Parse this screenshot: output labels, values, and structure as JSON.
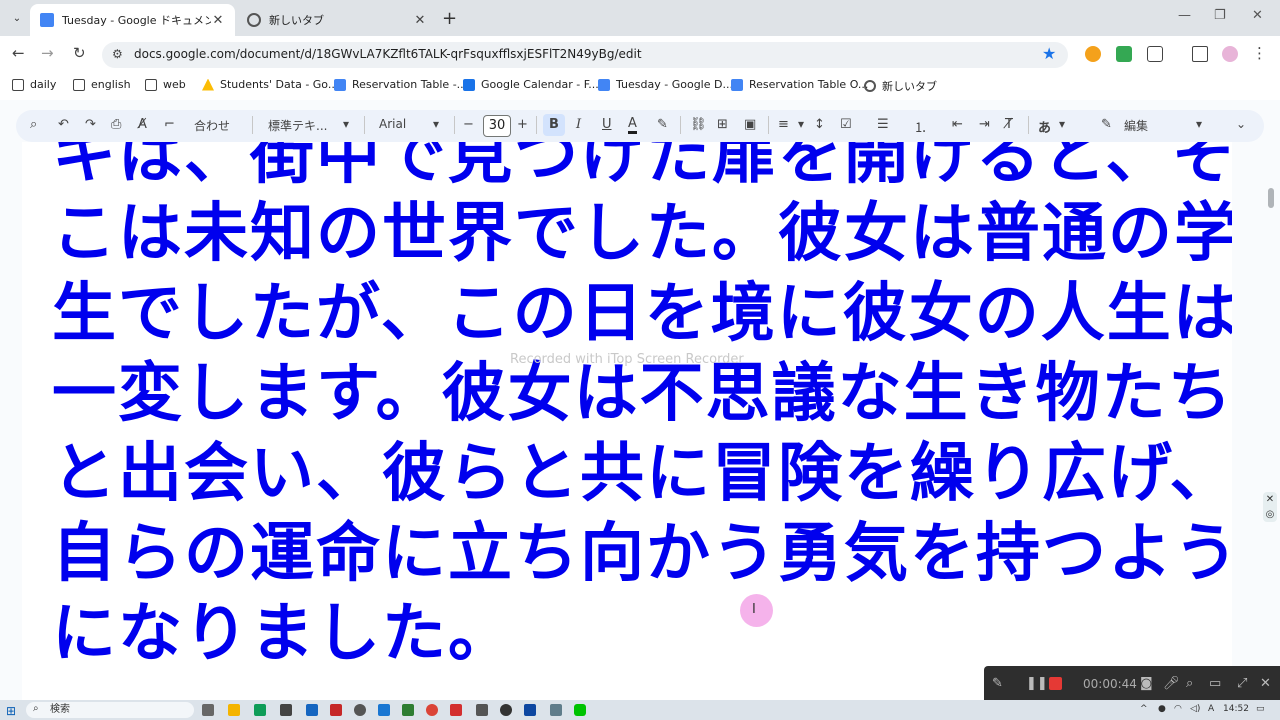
{
  "browser": {
    "tabs": [
      {
        "label": "Tuesday - Google ドキュメント",
        "active": true
      },
      {
        "label": "新しいタブ",
        "active": false
      }
    ],
    "url": "docs.google.com/document/d/18GWvLA7KZflt6TALK-qrFsquxfflsxjESFlT2N49yBg/edit"
  },
  "bookmarks": [
    {
      "label": "daily",
      "icon": "folder-icon"
    },
    {
      "label": "english",
      "icon": "folder-icon"
    },
    {
      "label": "web",
      "icon": "folder-icon"
    },
    {
      "label": "Students' Data - Go...",
      "icon": "drive-icon"
    },
    {
      "label": "Reservation Table -...",
      "icon": "docs-icon"
    },
    {
      "label": "Google Calendar - F...",
      "icon": "calendar-icon"
    },
    {
      "label": "Tuesday - Google D...",
      "icon": "docs-icon"
    },
    {
      "label": "Reservation Table O...",
      "icon": "docs-icon"
    },
    {
      "label": "新しいタブ",
      "icon": "chrome-icon"
    }
  ],
  "docs_toolbar": {
    "zoom": "合わせ",
    "style": "標準テキ...",
    "font": "Arial",
    "font_size": "30",
    "bold": "B",
    "italic": "I",
    "underline": "U",
    "text_color": "A",
    "input_mode": "あ",
    "edit_mode": "編集"
  },
  "document": {
    "lines": [
      "キは、街中で見つけた扉を開けると、そ",
      "こは未知の世界でした。彼女は普通の学",
      "生でしたが、この日を境に彼女の人生は",
      "一変します。彼女は不思議な生き物たち",
      "と出会い、彼らと共に冒険を繰り広げ、",
      "自らの運命に立ち向かう勇気を持つよう",
      "になりました。"
    ],
    "text_color": "#0000ee"
  },
  "overlay": {
    "watermark": "Recorded with iTop Screen Recorder"
  },
  "recorder": {
    "time": "00:00:44"
  },
  "taskbar": {
    "search_label": "検索",
    "ime": "A",
    "clock": "14:52"
  }
}
